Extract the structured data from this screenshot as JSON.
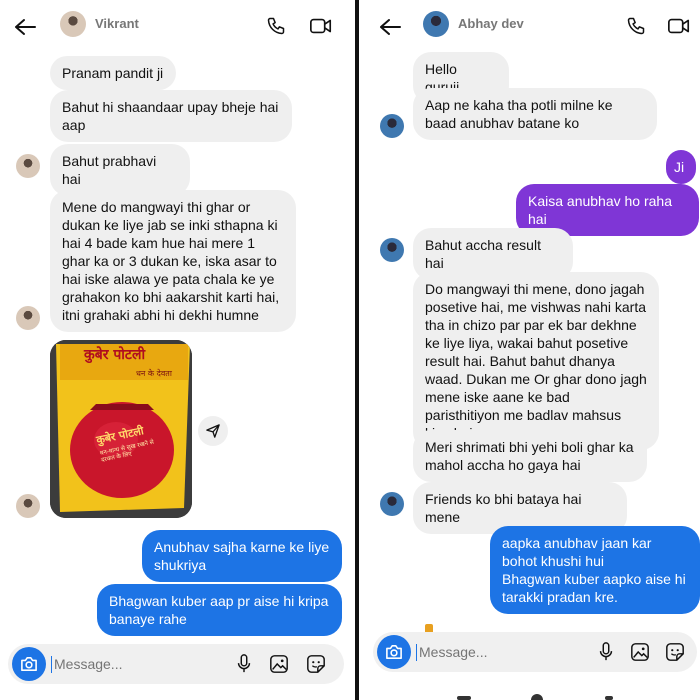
{
  "left": {
    "header": {
      "name": "Vikrant"
    },
    "messages": [
      "Pranam pandit ji",
      "Bahut hi shaandaar upay bheje hai aap",
      "Bahut prabhavi hai",
      "Mene do mangwayi thi ghar or dukan ke liye jab se inki sthapna ki hai 4 bade kam hue hai mere 1 ghar ka or 3 dukan ke, iska asar to hai iske alawa ye pata chala ke ye grahakon ko bhi aakarshit karti hai, itni grahaki abhi hi dekhi humne",
      "Anubhav sajha karne ke liye shukriya",
      "Bhagwan kuber aap pr aise hi kripa banaye rahe"
    ],
    "photo": {
      "header_text": "कुबेर पोटली",
      "subheader_text": "धन के देवता",
      "center_text": "कुबेर पोटली",
      "small_text": "धन-धान्य से सुख रखने से दरकत के लिए"
    },
    "composer": {
      "placeholder": "Message..."
    }
  },
  "right": {
    "header": {
      "name": "Abhay dev"
    },
    "messages": [
      "Hello guruji,",
      "Aap ne kaha tha potli milne ke baad anubhav batane ko",
      "Ji",
      "Kaisa anubhav ho raha hai",
      "Bahut accha result hai",
      "Do mangwayi thi mene, dono jagah posetive hai, me vishwas nahi karta tha in chizo par par ek bar dekhne ke liye liya, wakai bahut posetive result hai. Bahut bahut dhanya waad.  Dukan me Or ghar dono jagh mene iske aane ke bad paristhitiyon me badlav mahsus kiya hai",
      "Meri shrimati bhi yehi boli ghar ka mahol accha ho gaya hai",
      "Friends ko bhi bataya hai mene",
      "aapka anubhav jaan kar bohot khushi hui\nBhagwan kuber aapko aise hi tarakki pradan kre."
    ],
    "composer": {
      "placeholder": "Message..."
    }
  },
  "colors": {
    "outgoing_blue": "#1d74e5",
    "outgoing_purple": "#7f36d6",
    "incoming_gray": "#efefef"
  },
  "icons": [
    "back-arrow-icon",
    "phone-icon",
    "video-icon",
    "camera-icon",
    "microphone-icon",
    "image-icon",
    "sticker-icon",
    "share-icon"
  ]
}
